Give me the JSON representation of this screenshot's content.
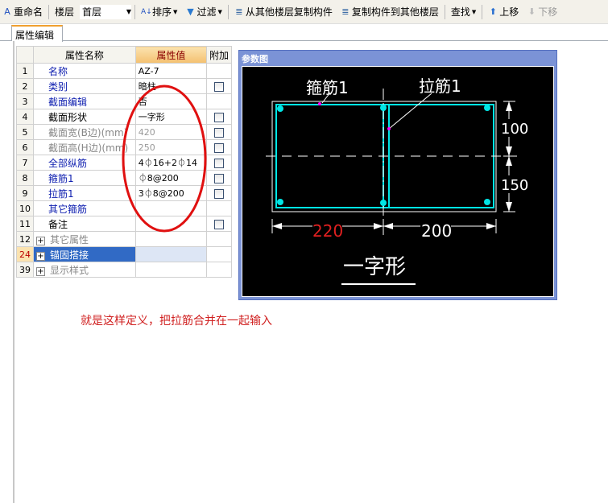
{
  "toolbar": {
    "rename": "重命名",
    "floor_label": "楼层",
    "floor_value": "首层",
    "sort": "排序",
    "filter": "过滤",
    "copy_from": "从其他楼层复制构件",
    "copy_to": "复制构件到其他楼层",
    "find": "查找",
    "move_up": "上移",
    "move_down": "下移"
  },
  "tab": "属性编辑",
  "table": {
    "headers": [
      "属性名称",
      "属性值",
      "附加"
    ],
    "rows": [
      {
        "num": "1",
        "name": "名称",
        "value": "AZ-7",
        "style": "blue",
        "checkbox": false
      },
      {
        "num": "2",
        "name": "类别",
        "value": "暗柱",
        "style": "blue",
        "checkbox": true
      },
      {
        "num": "3",
        "name": "截面编辑",
        "value": "否",
        "style": "blue",
        "checkbox": false
      },
      {
        "num": "4",
        "name": "截面形状",
        "value": "一字形",
        "style": "blk",
        "checkbox": true
      },
      {
        "num": "5",
        "name": "截面宽(B边)(mm)",
        "value": "420",
        "style": "gray",
        "checkbox": true
      },
      {
        "num": "6",
        "name": "截面高(H边)(mm)",
        "value": "250",
        "style": "gray",
        "checkbox": true
      },
      {
        "num": "7",
        "name": "全部纵筋",
        "value": "4⏀16+2⏀14",
        "style": "blue",
        "checkbox": true
      },
      {
        "num": "8",
        "name": "箍筋1",
        "value": "⏀8@200",
        "style": "blue",
        "checkbox": true
      },
      {
        "num": "9",
        "name": "拉筋1",
        "value": "3⏀8@200",
        "style": "blue",
        "checkbox": true
      },
      {
        "num": "10",
        "name": "其它箍筋",
        "value": "",
        "style": "blue",
        "checkbox": false
      },
      {
        "num": "11",
        "name": "备注",
        "value": "",
        "style": "blk",
        "checkbox": true
      },
      {
        "num": "12",
        "name": "其它属性",
        "value": "",
        "style": "grp",
        "checkbox": false
      },
      {
        "num": "24",
        "name": "锚固搭接",
        "value": "",
        "style": "sel",
        "checkbox": false
      },
      {
        "num": "39",
        "name": "显示样式",
        "value": "",
        "style": "grp",
        "checkbox": false
      }
    ]
  },
  "diagram": {
    "title": "参数图",
    "label_stirrup": "箍筋1",
    "label_tie": "拉筋1",
    "dim_top": "100",
    "dim_bottom": "150",
    "dim_left": "220",
    "dim_right": "200",
    "shape_name": "一字形",
    "colors": {
      "rebar": "#00e5e5",
      "dim": "#ffffff",
      "highlight": "#e02020",
      "marker": "#ff00ff"
    }
  },
  "annotation": {
    "text": "就是这样定义，把拉筋合并在一起输入",
    "color": "#d02020"
  }
}
